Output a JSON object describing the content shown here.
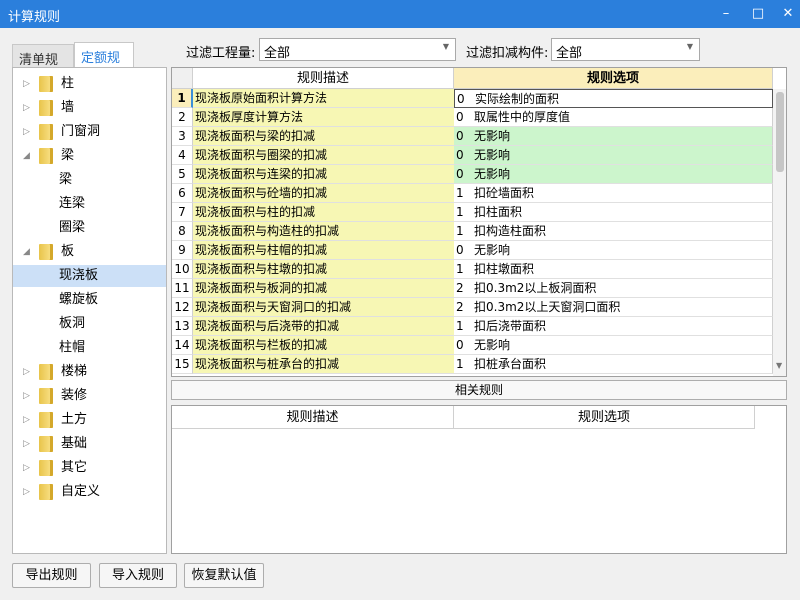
{
  "window": {
    "title": "计算规则",
    "minimize": "–",
    "maximize": "□",
    "close": "✕"
  },
  "tabs": [
    {
      "label": "清单规则"
    },
    {
      "label": "定额规则",
      "active": true
    }
  ],
  "tree": [
    {
      "label": "柱",
      "level": 0,
      "expandable": true
    },
    {
      "label": "墙",
      "level": 0,
      "expandable": true
    },
    {
      "label": "门窗洞",
      "level": 0,
      "expandable": true
    },
    {
      "label": "梁",
      "level": 0,
      "expanded": true
    },
    {
      "label": "梁",
      "level": 1
    },
    {
      "label": "连梁",
      "level": 1
    },
    {
      "label": "圈梁",
      "level": 1
    },
    {
      "label": "板",
      "level": 0,
      "expanded": true
    },
    {
      "label": "现浇板",
      "level": 1,
      "selected": true
    },
    {
      "label": "螺旋板",
      "level": 1
    },
    {
      "label": "板洞",
      "level": 1
    },
    {
      "label": "柱帽",
      "level": 1
    },
    {
      "label": "楼梯",
      "level": 0,
      "expandable": true
    },
    {
      "label": "装修",
      "level": 0,
      "expandable": true
    },
    {
      "label": "土方",
      "level": 0,
      "expandable": true
    },
    {
      "label": "基础",
      "level": 0,
      "expandable": true
    },
    {
      "label": "其它",
      "level": 0,
      "expandable": true
    },
    {
      "label": "自定义",
      "level": 0,
      "expandable": true
    }
  ],
  "filters": {
    "quantity_label": "过滤工程量:",
    "quantity_value": "全部",
    "deduct_label": "过滤扣减构件:",
    "deduct_value": "全部"
  },
  "grid": {
    "headers": [
      "规则描述",
      "规则选项"
    ],
    "rows": [
      {
        "n": "1",
        "desc": "现浇板原始面积计算方法",
        "val": "0",
        "opt": "实际绘制的面积"
      },
      {
        "n": "2",
        "desc": "现浇板厚度计算方法",
        "val": "0",
        "opt": "取属性中的厚度值"
      },
      {
        "n": "3",
        "desc": "现浇板面积与梁的扣减",
        "val": "0",
        "opt": "无影响",
        "hl": true
      },
      {
        "n": "4",
        "desc": "现浇板面积与圈梁的扣减",
        "val": "0",
        "opt": "无影响",
        "hl": true
      },
      {
        "n": "5",
        "desc": "现浇板面积与连梁的扣减",
        "val": "0",
        "opt": "无影响",
        "hl": true
      },
      {
        "n": "6",
        "desc": "现浇板面积与砼墙的扣减",
        "val": "1",
        "opt": "扣砼墙面积"
      },
      {
        "n": "7",
        "desc": "现浇板面积与柱的扣减",
        "val": "1",
        "opt": "扣柱面积"
      },
      {
        "n": "8",
        "desc": "现浇板面积与构造柱的扣减",
        "val": "1",
        "opt": "扣构造柱面积"
      },
      {
        "n": "9",
        "desc": "现浇板面积与柱帽的扣减",
        "val": "0",
        "opt": "无影响"
      },
      {
        "n": "10",
        "desc": "现浇板面积与柱墩的扣减",
        "val": "1",
        "opt": "扣柱墩面积"
      },
      {
        "n": "11",
        "desc": "现浇板面积与板洞的扣减",
        "val": "2",
        "opt": "扣0.3m2以上板洞面积"
      },
      {
        "n": "12",
        "desc": "现浇板面积与天窗洞口的扣减",
        "val": "2",
        "opt": "扣0.3m2以上天窗洞口面积"
      },
      {
        "n": "13",
        "desc": "现浇板面积与后浇带的扣减",
        "val": "1",
        "opt": "扣后浇带面积"
      },
      {
        "n": "14",
        "desc": "现浇板面积与栏板的扣减",
        "val": "0",
        "opt": "无影响"
      },
      {
        "n": "15",
        "desc": "现浇板面积与桩承台的扣减",
        "val": "1",
        "opt": "扣桩承台面积"
      }
    ]
  },
  "related": {
    "button": "相关规则",
    "headers": [
      "规则描述",
      "规则选项"
    ]
  },
  "buttons": {
    "export": "导出规则",
    "import": "导入规则",
    "reset": "恢复默认值"
  },
  "colors": {
    "titlebar": "#2b7fdc",
    "desc_bg": "#f7f7b4",
    "highlight_bg": "#ccf5cc",
    "header_selected": "#fbeebb"
  }
}
